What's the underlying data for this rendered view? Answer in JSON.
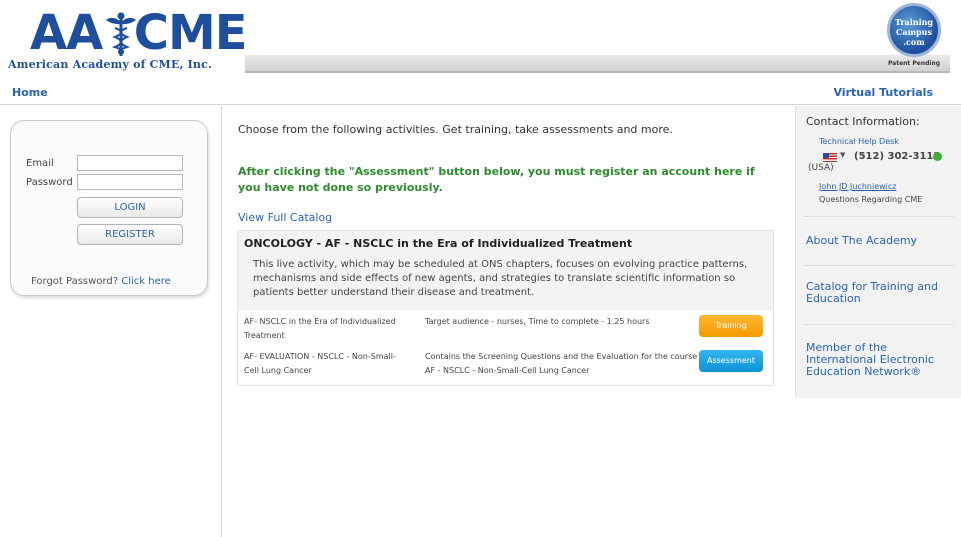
{
  "header": {
    "logo_main": "AA CME",
    "logo_sub": "American Academy of CME, Inc.",
    "badge_text": "Training Campus .com",
    "badge_caption": "Patent Pending"
  },
  "nav": {
    "home": "Home",
    "virtual_tutorials": "Virtual Tutorials"
  },
  "login": {
    "email_label": "Email",
    "password_label": "Password",
    "email_value": "",
    "password_value": "",
    "login_button": "LOGIN",
    "register_button": "REGISTER",
    "forgot_text": "Forgot Password?",
    "forgot_link": "Click here"
  },
  "main": {
    "intro": "Choose from the following activities. Get training, take assessments and more.",
    "notice": "After clicking the \"Assessment\" button below, you must register an account here if you have not done so previously.",
    "catalog_link": "View Full Catalog",
    "course": {
      "title": "ONCOLOGY - AF - NSCLC in the Era of Individualized Treatment",
      "description": "This live activity, which may be scheduled at ONS chapters, focuses on evolving practice patterns, mechanisms and side effects of new agents, and strategies to translate scientific information so patients better understand their disease and treatment.",
      "rows": [
        {
          "name": "AF- NSCLC in the Era of Individualized Treatment",
          "info": "Target audience - nurses, Time to complete - 1.25 hours",
          "button": "Training"
        },
        {
          "name": "AF- EVALUATION - NSCLC - Non-Small-Cell Lung Cancer",
          "info": "Contains the Screening Questions and the Evaluation for the course AF - NSCLC - Non-Small-Cell Lung Cancer",
          "button": "Assessment"
        }
      ]
    }
  },
  "sidebar": {
    "contact_title": "Contact Information:",
    "tech_help": "Technical Help Desk",
    "phone": "(512) 302-3113",
    "phone_country": "(USA)",
    "contact_name": "John JD Juchniewicz",
    "questions": "Questions Regarding CME",
    "links": [
      "About The Academy",
      "Catalog for Training and Education",
      "Member of the International Electronic Education Network®"
    ]
  },
  "colors": {
    "brand_blue": "#1f4e9c",
    "link_blue": "#2a64b0",
    "notice_green": "#2e8b2e",
    "training_orange": "#f59a00",
    "assessment_blue": "#0f92d4"
  }
}
